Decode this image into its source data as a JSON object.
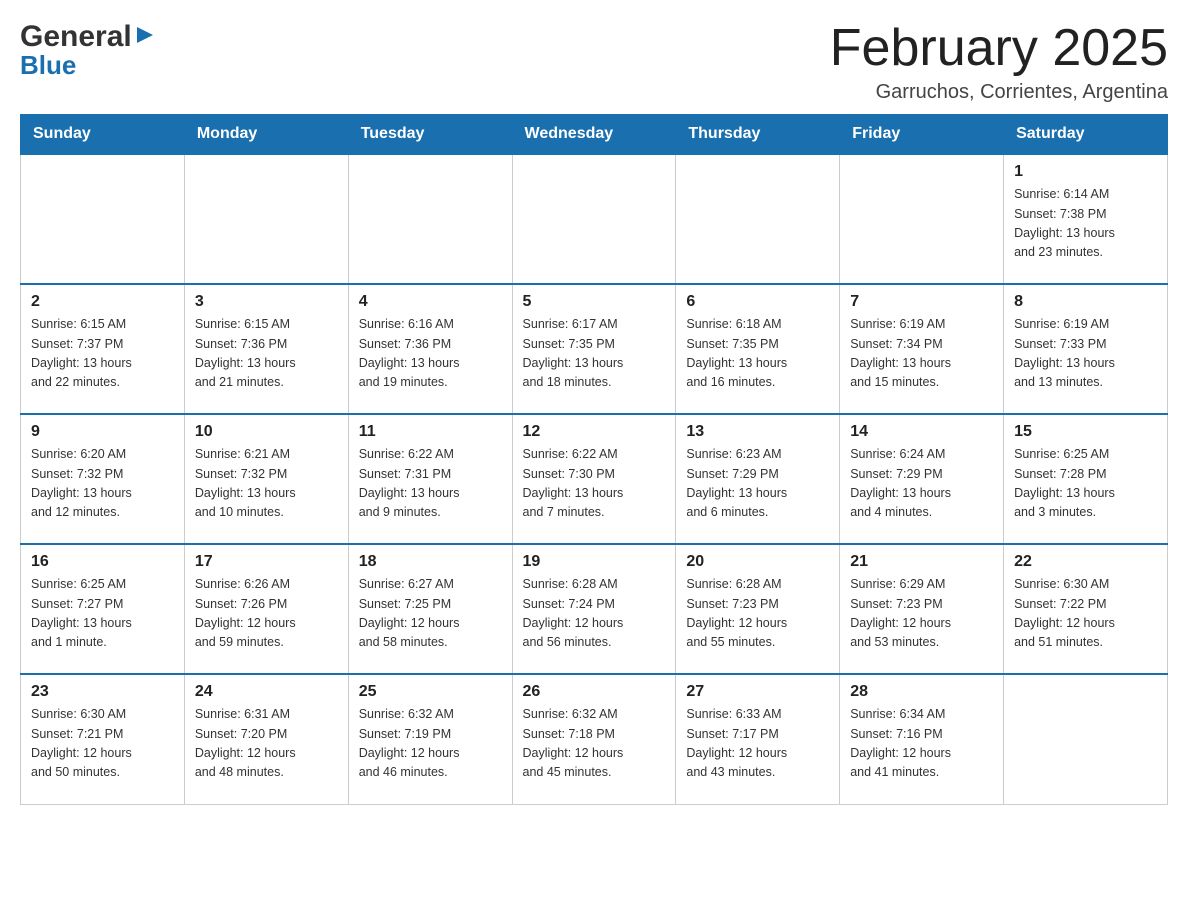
{
  "header": {
    "logo_general": "General",
    "logo_blue": "Blue",
    "month_title": "February 2025",
    "location": "Garruchos, Corrientes, Argentina"
  },
  "weekdays": [
    "Sunday",
    "Monday",
    "Tuesday",
    "Wednesday",
    "Thursday",
    "Friday",
    "Saturday"
  ],
  "weeks": [
    [
      {
        "day": "",
        "info": ""
      },
      {
        "day": "",
        "info": ""
      },
      {
        "day": "",
        "info": ""
      },
      {
        "day": "",
        "info": ""
      },
      {
        "day": "",
        "info": ""
      },
      {
        "day": "",
        "info": ""
      },
      {
        "day": "1",
        "info": "Sunrise: 6:14 AM\nSunset: 7:38 PM\nDaylight: 13 hours\nand 23 minutes."
      }
    ],
    [
      {
        "day": "2",
        "info": "Sunrise: 6:15 AM\nSunset: 7:37 PM\nDaylight: 13 hours\nand 22 minutes."
      },
      {
        "day": "3",
        "info": "Sunrise: 6:15 AM\nSunset: 7:36 PM\nDaylight: 13 hours\nand 21 minutes."
      },
      {
        "day": "4",
        "info": "Sunrise: 6:16 AM\nSunset: 7:36 PM\nDaylight: 13 hours\nand 19 minutes."
      },
      {
        "day": "5",
        "info": "Sunrise: 6:17 AM\nSunset: 7:35 PM\nDaylight: 13 hours\nand 18 minutes."
      },
      {
        "day": "6",
        "info": "Sunrise: 6:18 AM\nSunset: 7:35 PM\nDaylight: 13 hours\nand 16 minutes."
      },
      {
        "day": "7",
        "info": "Sunrise: 6:19 AM\nSunset: 7:34 PM\nDaylight: 13 hours\nand 15 minutes."
      },
      {
        "day": "8",
        "info": "Sunrise: 6:19 AM\nSunset: 7:33 PM\nDaylight: 13 hours\nand 13 minutes."
      }
    ],
    [
      {
        "day": "9",
        "info": "Sunrise: 6:20 AM\nSunset: 7:32 PM\nDaylight: 13 hours\nand 12 minutes."
      },
      {
        "day": "10",
        "info": "Sunrise: 6:21 AM\nSunset: 7:32 PM\nDaylight: 13 hours\nand 10 minutes."
      },
      {
        "day": "11",
        "info": "Sunrise: 6:22 AM\nSunset: 7:31 PM\nDaylight: 13 hours\nand 9 minutes."
      },
      {
        "day": "12",
        "info": "Sunrise: 6:22 AM\nSunset: 7:30 PM\nDaylight: 13 hours\nand 7 minutes."
      },
      {
        "day": "13",
        "info": "Sunrise: 6:23 AM\nSunset: 7:29 PM\nDaylight: 13 hours\nand 6 minutes."
      },
      {
        "day": "14",
        "info": "Sunrise: 6:24 AM\nSunset: 7:29 PM\nDaylight: 13 hours\nand 4 minutes."
      },
      {
        "day": "15",
        "info": "Sunrise: 6:25 AM\nSunset: 7:28 PM\nDaylight: 13 hours\nand 3 minutes."
      }
    ],
    [
      {
        "day": "16",
        "info": "Sunrise: 6:25 AM\nSunset: 7:27 PM\nDaylight: 13 hours\nand 1 minute."
      },
      {
        "day": "17",
        "info": "Sunrise: 6:26 AM\nSunset: 7:26 PM\nDaylight: 12 hours\nand 59 minutes."
      },
      {
        "day": "18",
        "info": "Sunrise: 6:27 AM\nSunset: 7:25 PM\nDaylight: 12 hours\nand 58 minutes."
      },
      {
        "day": "19",
        "info": "Sunrise: 6:28 AM\nSunset: 7:24 PM\nDaylight: 12 hours\nand 56 minutes."
      },
      {
        "day": "20",
        "info": "Sunrise: 6:28 AM\nSunset: 7:23 PM\nDaylight: 12 hours\nand 55 minutes."
      },
      {
        "day": "21",
        "info": "Sunrise: 6:29 AM\nSunset: 7:23 PM\nDaylight: 12 hours\nand 53 minutes."
      },
      {
        "day": "22",
        "info": "Sunrise: 6:30 AM\nSunset: 7:22 PM\nDaylight: 12 hours\nand 51 minutes."
      }
    ],
    [
      {
        "day": "23",
        "info": "Sunrise: 6:30 AM\nSunset: 7:21 PM\nDaylight: 12 hours\nand 50 minutes."
      },
      {
        "day": "24",
        "info": "Sunrise: 6:31 AM\nSunset: 7:20 PM\nDaylight: 12 hours\nand 48 minutes."
      },
      {
        "day": "25",
        "info": "Sunrise: 6:32 AM\nSunset: 7:19 PM\nDaylight: 12 hours\nand 46 minutes."
      },
      {
        "day": "26",
        "info": "Sunrise: 6:32 AM\nSunset: 7:18 PM\nDaylight: 12 hours\nand 45 minutes."
      },
      {
        "day": "27",
        "info": "Sunrise: 6:33 AM\nSunset: 7:17 PM\nDaylight: 12 hours\nand 43 minutes."
      },
      {
        "day": "28",
        "info": "Sunrise: 6:34 AM\nSunset: 7:16 PM\nDaylight: 12 hours\nand 41 minutes."
      },
      {
        "day": "",
        "info": ""
      }
    ]
  ]
}
